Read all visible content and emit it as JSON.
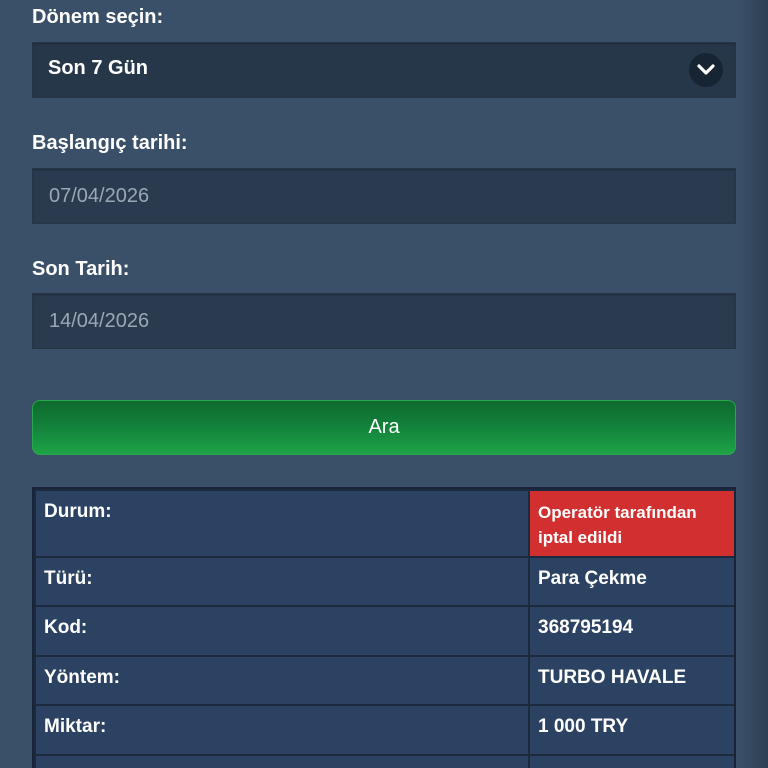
{
  "period": {
    "label": "Dönem seçin:",
    "selected": "Son 7 Gün"
  },
  "start_date": {
    "label": "Başlangıç tarihi:",
    "value": "07/04/2026"
  },
  "end_date": {
    "label": "Son Tarih:",
    "value": "14/04/2026"
  },
  "search_button": {
    "label": "Ara"
  },
  "transaction": {
    "rows": [
      {
        "label": "Durum:",
        "value": "Operatör tarafından iptal edildi"
      },
      {
        "label": "Türü:",
        "value": "Para Çekme"
      },
      {
        "label": "Kod:",
        "value": "368795194"
      },
      {
        "label": "Yöntem:",
        "value": "TURBO HAVALE"
      },
      {
        "label": "Miktar:",
        "value": "1 000 TRY"
      }
    ]
  },
  "colors": {
    "background": "#3a5068",
    "search_button": "#12803a",
    "status_cancelled": "#d12f30",
    "table_cell": "#2c4262"
  },
  "icons": {
    "period_dropdown": "chevron-down-icon"
  }
}
